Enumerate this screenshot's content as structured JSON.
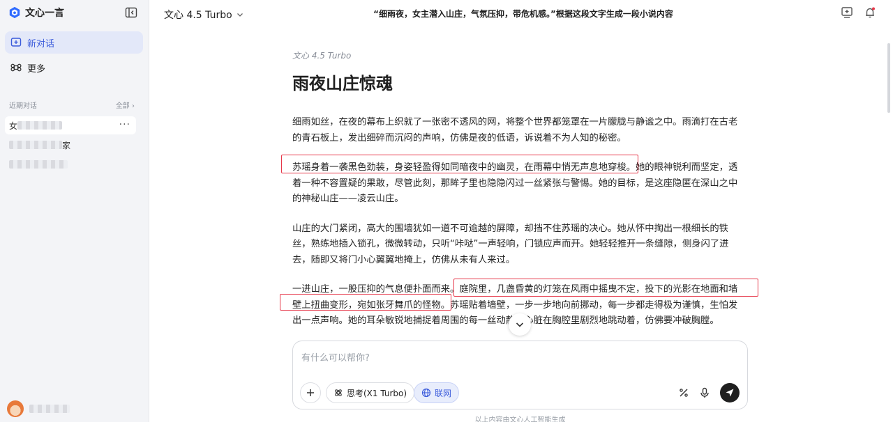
{
  "sidebar": {
    "brand": "文心一言",
    "nav": {
      "new_chat": "新对话",
      "more": "更多"
    },
    "recent_title": "近期对话",
    "recent_all": "全部 ›",
    "history": [
      {
        "prefix": "女",
        "suffix": ""
      },
      {
        "prefix": "",
        "suffix": "家"
      },
      {
        "prefix": "",
        "suffix": ""
      }
    ],
    "history_more": "···"
  },
  "header": {
    "model": "文心 4.5 Turbo",
    "conversation_title": "“细雨夜，女主潜入山庄，气氛压抑，带危机感。”根据这段文字生成一段小说内容"
  },
  "message": {
    "model_tag": "文心 4.5 Turbo",
    "title": "雨夜山庄惊魂",
    "paragraphs": [
      "细雨如丝，在夜的幕布上织就了一张密不透风的网，将整个世界都笼罩在一片朦胧与静谧之中。雨滴打在古老的青石板上，发出细碎而沉闷的声响，仿佛是夜的低语，诉说着不为人知的秘密。",
      "苏瑶身着一袭黑色劲装，身姿轻盈得如同暗夜中的幽灵，在雨幕中悄无声息地穿梭。她的眼神锐利而坚定，透着一种不容置疑的果敢，尽管此刻，那眸子里也隐隐闪过一丝紧张与警惕。她的目标，是这座隐匿在深山之中的神秘山庄——凌云山庄。",
      "山庄的大门紧闭，高大的围墙犹如一道不可逾越的屏障，却挡不住苏瑶的决心。她从怀中掏出一根细长的铁丝，熟练地插入锁孔，微微转动，只听“咔哒”一声轻响，门锁应声而开。她轻轻推开一条缝隙，侧身闪了进去，随即又将门小心翼翼地掩上，仿佛从未有人来过。",
      "一进山庄，一股压抑的气息便扑面而来。庭院里，几盏昏黄的灯笼在风雨中摇曳不定，投下的光影在地面和墙壁上扭曲变形，宛如张牙舞爪的怪物。苏瑶贴着墙壁，一步一步地向前挪动，每一步都走得极为谨慎，生怕发出一点声响。她的耳朵敏锐地捕捉着周围的每一丝动静，心脏在胸腔里剧烈地跳动着，仿佛要冲破胸膛。"
    ]
  },
  "composer": {
    "placeholder": "有什么可以帮你?",
    "think_label": "思考(X1 Turbo)",
    "web_label": "联网"
  },
  "footer_note": "以上内容由文心人工智能生成",
  "colors": {
    "accent": "#3b5bdb",
    "highlight_box": "#e6384a",
    "sidebar_bg": "#f3f4f7"
  }
}
